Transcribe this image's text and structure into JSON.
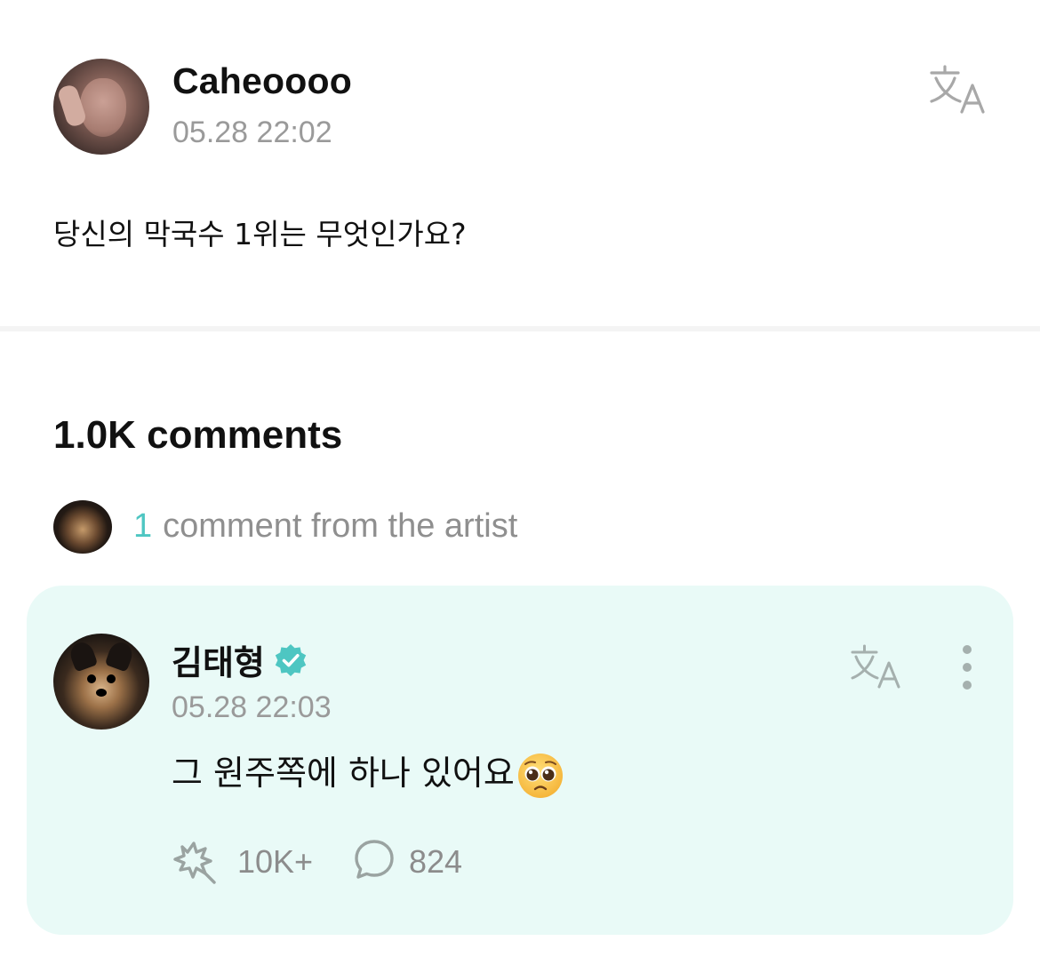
{
  "post": {
    "author": "Caheoooo",
    "timestamp": "05.28 22:02",
    "body": "당신의 막국수 1위는 무엇인가요?"
  },
  "comments": {
    "count_label": "1.0K comments",
    "artist_count": "1",
    "artist_label": "comment from the artist"
  },
  "artist_comment": {
    "author": "김태형",
    "verified": true,
    "timestamp": "05.28 22:03",
    "text": "그 원주쪽에 하나 있어요",
    "emoji": "pleading-face",
    "likes": "10K+",
    "replies": "824"
  },
  "colors": {
    "card_background": "#e9faf7",
    "accent_teal": "#4ec6c2",
    "muted_text": "#9a9a9a"
  }
}
